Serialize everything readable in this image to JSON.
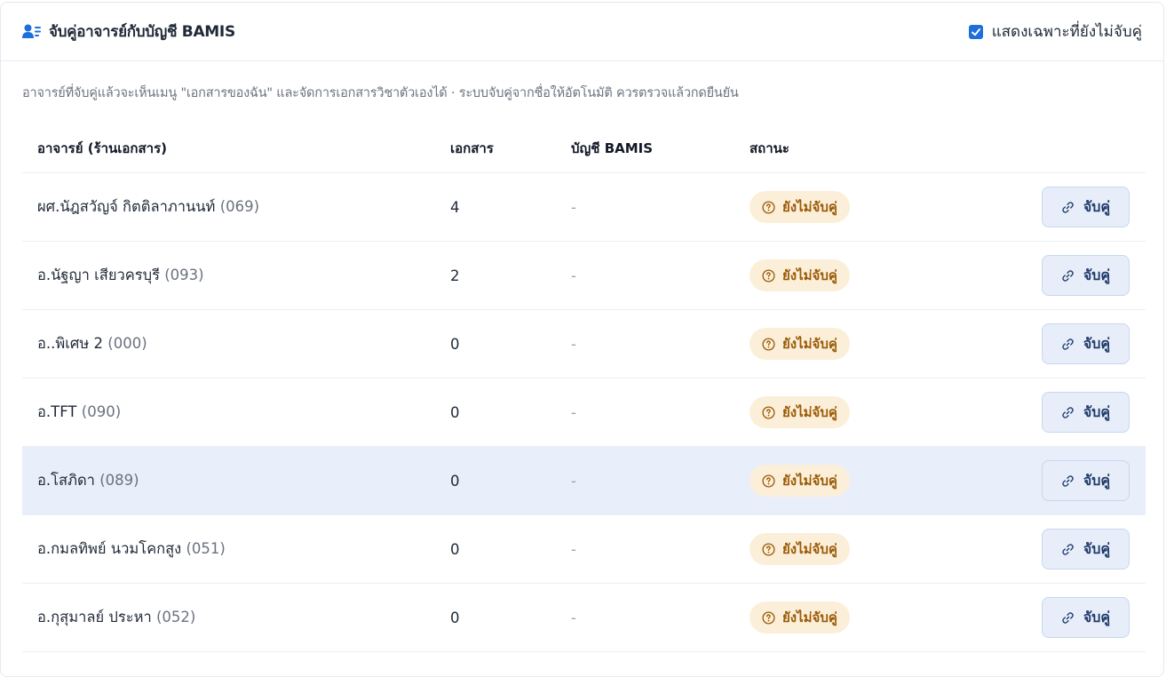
{
  "header": {
    "title": "จับคู่อาจารย์กับบัญชี BAMIS",
    "icon": "user-list-icon",
    "filter_label": "แสดงเฉพาะที่ยังไม่จับคู่",
    "filter_checked": true
  },
  "description": "อาจารย์ที่จับคู่แล้วจะเห็นเมนู \"เอกสารของฉัน\" และจัดการเอกสารวิชาตัวเองได้ · ระบบจับคู่จากชื่อให้อัตโนมัติ ควรตรวจแล้วกดยืนยัน",
  "columns": {
    "teacher": "อาจารย์ (ร้านเอกสาร)",
    "documents": "เอกสาร",
    "account": "บัญชี BAMIS",
    "status": "สถานะ"
  },
  "rows": [
    {
      "name": "ผศ.นัฎสวัญจ์ กิตติลาภานนท์",
      "code": "(069)",
      "documents": "4",
      "account": "-",
      "status": "ยังไม่จับคู่",
      "action": "จับคู่"
    },
    {
      "name": "อ.นัฐญา เสียวครบุรี",
      "code": "(093)",
      "documents": "2",
      "account": "-",
      "status": "ยังไม่จับคู่",
      "action": "จับคู่"
    },
    {
      "name": "อ..พิเศษ 2",
      "code": "(000)",
      "documents": "0",
      "account": "-",
      "status": "ยังไม่จับคู่",
      "action": "จับคู่"
    },
    {
      "name": "อ.TFT",
      "code": "(090)",
      "documents": "0",
      "account": "-",
      "status": "ยังไม่จับคู่",
      "action": "จับคู่"
    },
    {
      "name": "อ.โสภิดา",
      "code": "(089)",
      "documents": "0",
      "account": "-",
      "status": "ยังไม่จับคู่",
      "action": "จับคู่"
    },
    {
      "name": "อ.กมลทิพย์ นวมโคกสูง",
      "code": "(051)",
      "documents": "0",
      "account": "-",
      "status": "ยังไม่จับคู่",
      "action": "จับคู่"
    },
    {
      "name": "อ.กุสุมาลย์ ประหา",
      "code": "(052)",
      "documents": "0",
      "account": "-",
      "status": "ยังไม่จับคู่",
      "action": "จับคู่"
    }
  ],
  "colors": {
    "accent": "#1d6fdc",
    "badge_bg": "#fcefd9",
    "badge_text": "#9a5a06",
    "button_bg": "#e7eef9",
    "row_highlight": "#e8eefa"
  },
  "icons": {
    "status": "question-circle-icon",
    "action": "link-icon"
  }
}
